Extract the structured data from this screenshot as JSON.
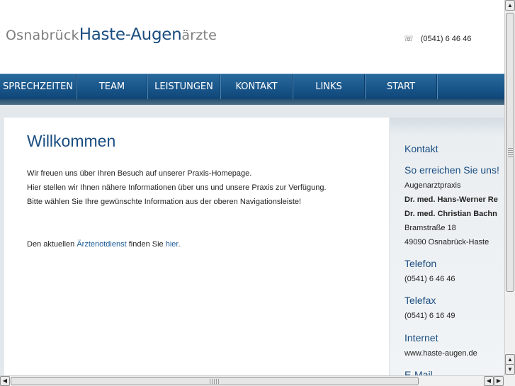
{
  "header": {
    "logo_city": "Osnabrück",
    "logo_name": "Haste-Augen",
    "logo_suffix": "ärzte",
    "phone_icon": "phone-icon",
    "phone_glyph": "☏",
    "phone": "(0541) 6 46 46"
  },
  "nav": {
    "items": [
      {
        "label": "SPRECHZEITEN"
      },
      {
        "label": "TEAM"
      },
      {
        "label": "LEISTUNGEN"
      },
      {
        "label": "KONTAKT"
      },
      {
        "label": "LINKS"
      },
      {
        "label": "START"
      }
    ]
  },
  "main": {
    "title": "Willkommen",
    "para1": "Wir freuen uns über Ihren Besuch auf unserer Praxis-Homepage.",
    "para2": "Hier stellen wir Ihnen nähere Informationen über uns und unsere Praxis zur Verfügung.",
    "para3": "Bitte wählen Sie Ihre gewünschte Information aus der oberen Navigationsleiste!",
    "notdienst_prefix": "Den aktuellen",
    "notdienst_link": "Ärztenotdienst",
    "notdienst_middle": "finden Sie",
    "notdienst_here": "hier",
    "notdienst_end": "."
  },
  "sidebar": {
    "title": "Kontakt",
    "subtitle": "So erreichen Sie uns!",
    "practice": "Augenarztpraxis",
    "doctor1": "Dr. med. Hans-Werner Re",
    "doctor2": "Dr. med. Christian Bachn",
    "street": "Bramstraße 18",
    "city": "49090 Osnabrück-Haste",
    "phone_label": "Telefon",
    "phone": "(0541)  6 46 46",
    "fax_label": "Telefax",
    "fax": "(0541)  6 16 49",
    "internet_label": "Internet",
    "internet": "www.haste-augen.de",
    "email_label": "E-Mail"
  },
  "scrollbars": {
    "up": "▲",
    "down": "▼",
    "left": "◀",
    "right": "▶"
  },
  "colors": {
    "brand_blue": "#1a4d80",
    "nav_blue": "#19558a",
    "link_blue": "#1a5a96",
    "band_grey": "#e3e8ec"
  }
}
